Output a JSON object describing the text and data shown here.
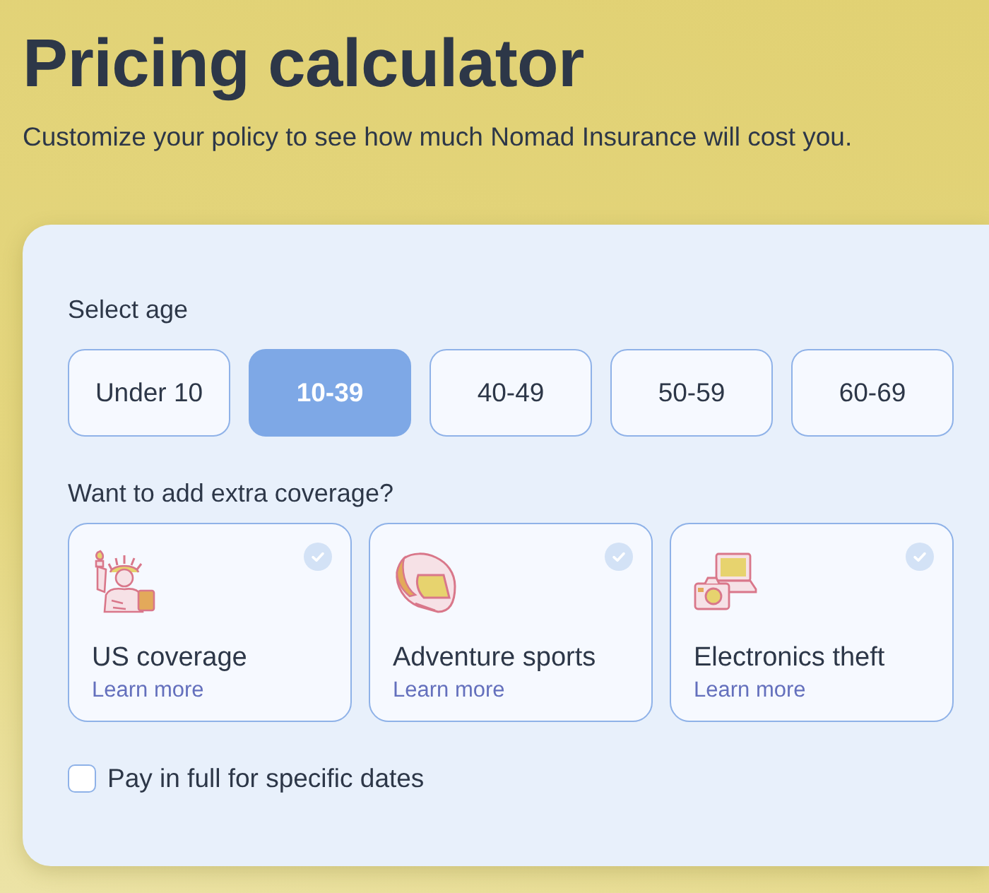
{
  "header": {
    "title": "Pricing calculator",
    "subtitle": "Customize your policy to see how much Nomad Insurance will cost you."
  },
  "age": {
    "label": "Select age",
    "options": [
      {
        "label": "Under 10",
        "selected": false
      },
      {
        "label": "10-39",
        "selected": true
      },
      {
        "label": "40-49",
        "selected": false
      },
      {
        "label": "50-59",
        "selected": false
      },
      {
        "label": "60-69",
        "selected": false
      }
    ]
  },
  "coverage": {
    "label": "Want to add extra coverage?",
    "options": [
      {
        "kind": "statue",
        "title": "US coverage",
        "link": "Learn more",
        "selected": false
      },
      {
        "kind": "helmet",
        "title": "Adventure sports",
        "link": "Learn more",
        "selected": false
      },
      {
        "kind": "electronics",
        "title": "Electronics theft",
        "link": "Learn more",
        "selected": false
      }
    ]
  },
  "pay_in_full": {
    "label": "Pay in full for specific dates",
    "checked": false
  }
}
